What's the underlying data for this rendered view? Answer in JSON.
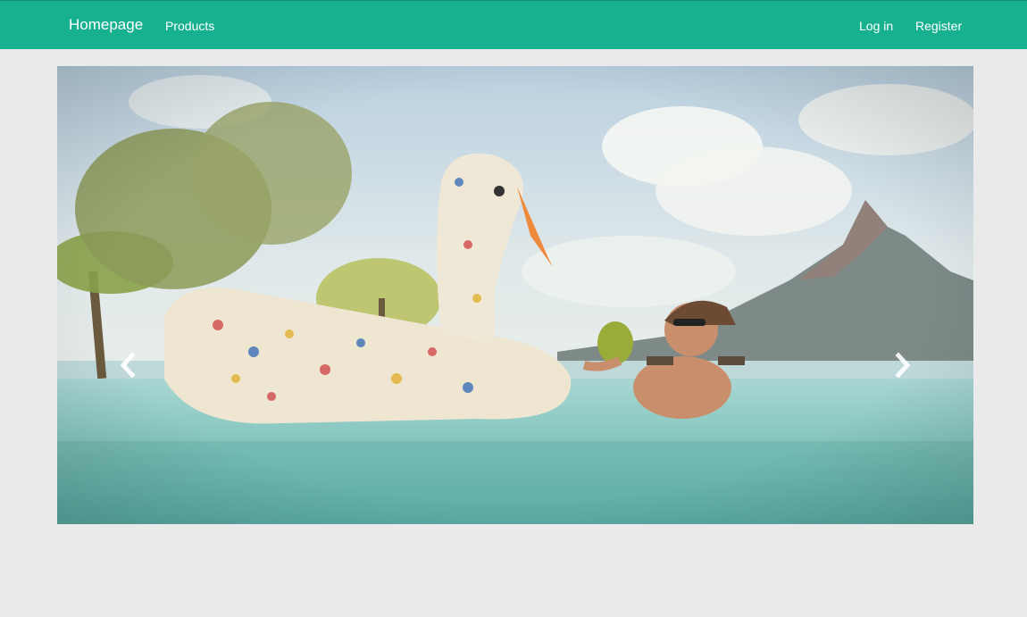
{
  "navbar": {
    "brand": "Homepage",
    "links": [
      {
        "label": "Products"
      }
    ],
    "right_links": [
      {
        "label": "Log in"
      },
      {
        "label": "Register"
      }
    ],
    "color": "#18b190"
  },
  "carousel": {
    "slide_count": 3,
    "active_index": 0,
    "prev_icon": "chevron-left-icon",
    "next_icon": "chevron-right-icon"
  }
}
